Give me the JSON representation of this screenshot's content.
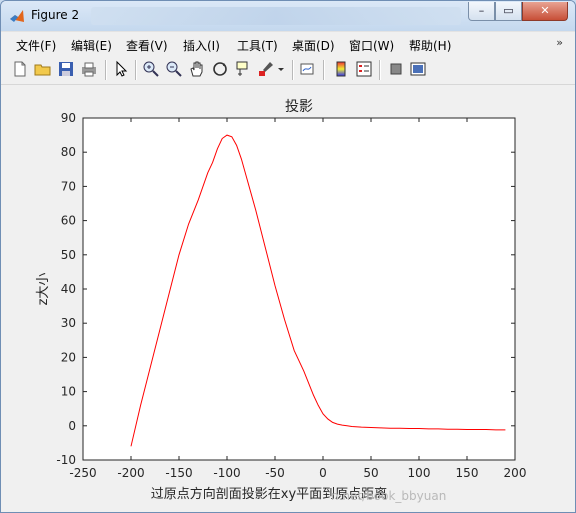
{
  "window": {
    "title": "Figure 2",
    "minimize_glyph": "–",
    "maximize_glyph": "▭",
    "close_glyph": "✕"
  },
  "menu": {
    "items": [
      "文件(F)",
      "编辑(E)",
      "查看(V)",
      "插入(I)",
      "工具(T)",
      "桌面(D)",
      "窗口(W)",
      "帮助(H)"
    ],
    "overflow_glyph": "»"
  },
  "toolbar": {
    "icons": [
      "new-figure-icon",
      "open-file-icon",
      "save-icon",
      "print-icon",
      "edit-plot-icon",
      "zoom-in-icon",
      "zoom-out-icon",
      "pan-icon",
      "rotate-3d-icon",
      "data-cursor-icon",
      "brush-icon",
      "link-plot-icon",
      "colorbar-icon",
      "legend-icon",
      "hide-plot-tools-icon",
      "show-plot-tools-icon"
    ]
  },
  "watermark": "n.net/book_bbyuan",
  "chart_data": {
    "type": "line",
    "title": "投影",
    "xlabel": "过原点方向剖面投影在xy平面到原点距离",
    "ylabel": "z大小",
    "xlim": [
      -250,
      200
    ],
    "ylim": [
      -10,
      90
    ],
    "xticks": [
      -250,
      -200,
      -150,
      -100,
      -50,
      0,
      50,
      100,
      150,
      200
    ],
    "yticks": [
      -10,
      0,
      10,
      20,
      30,
      40,
      50,
      60,
      70,
      80,
      90
    ],
    "grid": false,
    "series": [
      {
        "color": "#ff0000",
        "x": [
          -200,
          -190,
          -180,
          -170,
          -160,
          -150,
          -140,
          -130,
          -120,
          -115,
          -110,
          -105,
          -100,
          -95,
          -90,
          -85,
          -80,
          -70,
          -60,
          -50,
          -40,
          -30,
          -20,
          -10,
          -5,
          0,
          5,
          10,
          15,
          20,
          25,
          30,
          40,
          50,
          60,
          70,
          80,
          90,
          100,
          110,
          120,
          130,
          140,
          150,
          160,
          170,
          180,
          190
        ],
        "y": [
          -6,
          6,
          17,
          28,
          39,
          50,
          59,
          66,
          74,
          77,
          81,
          84,
          85,
          84.5,
          82,
          78,
          73,
          63,
          52,
          41,
          31,
          22,
          16,
          9,
          6,
          3.5,
          2,
          1,
          0.5,
          0.2,
          0.0,
          -0.2,
          -0.4,
          -0.5,
          -0.6,
          -0.7,
          -0.7,
          -0.8,
          -0.8,
          -0.9,
          -0.9,
          -1.0,
          -1.0,
          -1.1,
          -1.1,
          -1.1,
          -1.2,
          -1.2
        ]
      }
    ]
  }
}
